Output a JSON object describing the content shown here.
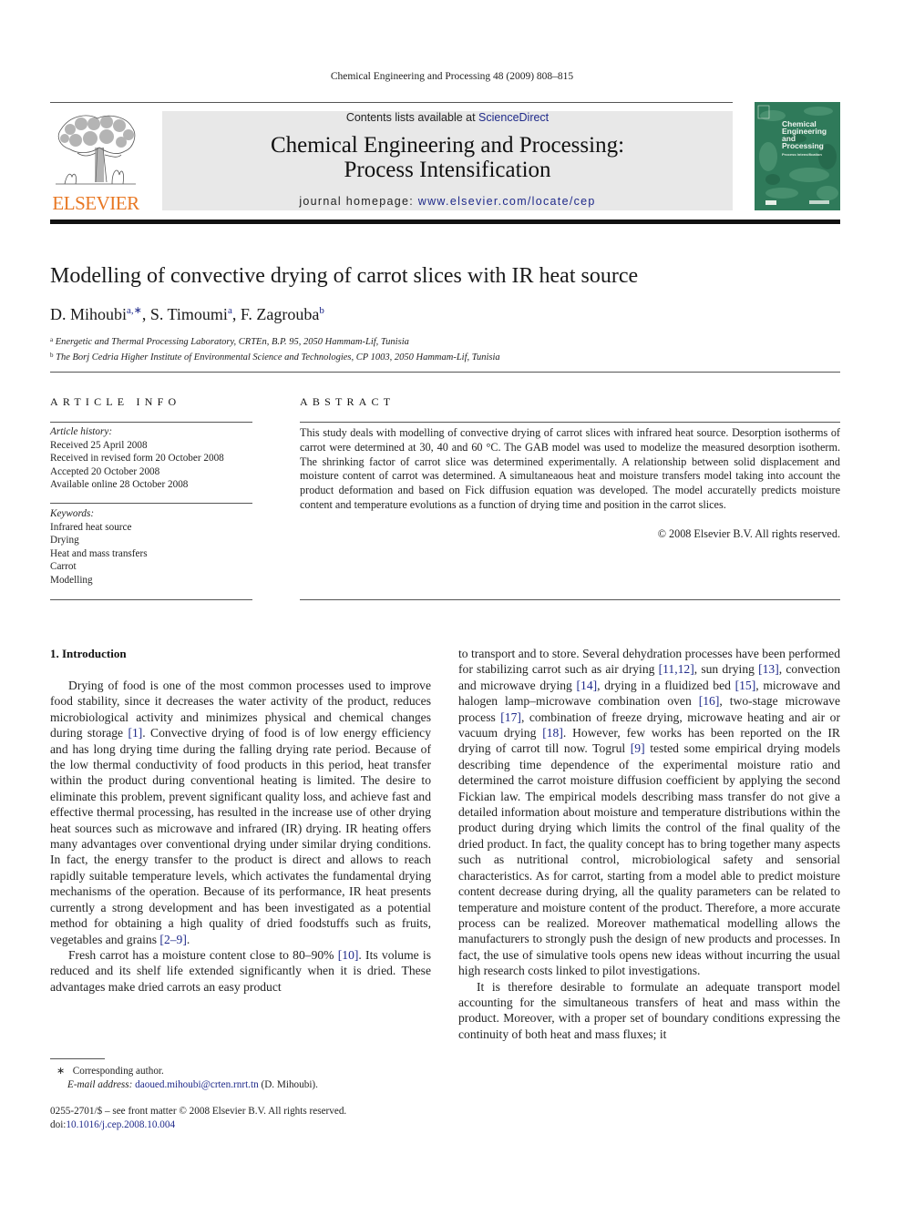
{
  "running_header": "Chemical Engineering and Processing 48 (2009) 808–815",
  "publisher": {
    "logo_word": "ELSEVIER",
    "logo_color": "#e87722"
  },
  "banner": {
    "contents_prefix": "Contents lists available at ",
    "contents_link": "ScienceDirect",
    "journal_title_line1": "Chemical Engineering and Processing:",
    "journal_title_line2": "Process Intensification",
    "homepage_prefix": "journal homepage: ",
    "homepage_link": "www.elsevier.com/locate/cep",
    "link_color": "#1f2a8a"
  },
  "cover": {
    "title_lines": [
      "Chemical",
      "Engineering",
      "and",
      "Processing"
    ],
    "subtitle": "Process Intensification",
    "color": "#2f7a5a"
  },
  "article": {
    "title": "Modelling of convective drying of carrot slices with IR heat source",
    "authors": [
      {
        "name": "D. Mihoubi",
        "sup": "a,∗",
        "sep": ", "
      },
      {
        "name": "S. Timoumi",
        "sup": "a",
        "sep": ", "
      },
      {
        "name": "F. Zagrouba",
        "sup": "b",
        "sep": ""
      }
    ],
    "affiliations": [
      {
        "mark": "a",
        "text": "Energetic and Thermal Processing Laboratory, CRTEn, B.P. 95, 2050 Hammam-Lif, Tunisia"
      },
      {
        "mark": "b",
        "text": "The Borj Cedria Higher Institute of Environmental Science and Technologies, CP 1003, 2050 Hammam-Lif, Tunisia"
      }
    ]
  },
  "article_info": {
    "heading": "ARTICLE INFO",
    "history_label": "Article history:",
    "history": [
      "Received 25 April 2008",
      "Received in revised form 20 October 2008",
      "Accepted 20 October 2008",
      "Available online 28 October 2008"
    ],
    "keywords_label": "Keywords:",
    "keywords": [
      "Infrared heat source",
      "Drying",
      "Heat and mass transfers",
      "Carrot",
      "Modelling"
    ]
  },
  "abstract": {
    "heading": "ABSTRACT",
    "text": "This study deals with modelling of convective drying of carrot slices with infrared heat source. Desorption isotherms of carrot were determined at 30, 40 and 60 °C. The GAB model was used to modelize the measured desorption isotherm. The shrinking factor of carrot slice was determined experimentally. A relationship between solid displacement and moisture content of carrot was determined. A simultaneaous heat and moisture transfers model taking into account the product deformation and based on Fick diffusion equation was developed. The model accuratelly predicts moisture content and temperature evolutions as a function of drying time and position in the carrot slices.",
    "copyright": "© 2008 Elsevier B.V. All rights reserved."
  },
  "introduction": {
    "heading": "1.  Introduction",
    "left_paragraphs": [
      [
        {
          "t": "Drying of food is one of the most common processes used to improve food stability, since it decreases the water activity of the product, reduces microbiological activity and minimizes physical and chemical changes during storage "
        },
        {
          "ref": "[1]"
        },
        {
          "t": ". Convective drying of food is of low energy efficiency and has long drying time during the falling drying rate period. Because of the low thermal conductivity of food products in this period, heat transfer within the product during conventional heating is limited. The desire to eliminate this problem, prevent significant quality loss, and achieve fast and effective thermal processing, has resulted in the increase use of other drying heat sources such as microwave and infrared (IR) drying. IR heating offers many advantages over conventional drying under similar drying conditions. In fact, the energy transfer to the product is direct and allows to reach rapidly suitable temperature levels, which activates the fundamental drying mechanisms of the operation. Because of its performance, IR heat presents currently a strong development and has been investigated as a potential method for obtaining a high quality of dried foodstuffs such as fruits, vegetables and grains "
        },
        {
          "ref": "[2–9]"
        },
        {
          "t": "."
        }
      ],
      [
        {
          "t": "Fresh carrot has a moisture content close to 80–90% "
        },
        {
          "ref": "[10]"
        },
        {
          "t": ". Its volume is reduced and its shelf life extended significantly when it is dried. These advantages make dried carrots an easy product"
        }
      ]
    ],
    "right_paragraphs": [
      [
        {
          "t": "to transport and to store. Several dehydration processes have been performed for stabilizing carrot such as air drying "
        },
        {
          "ref": "[11,12]"
        },
        {
          "t": ", sun drying "
        },
        {
          "ref": "[13]"
        },
        {
          "t": ", convection and microwave drying "
        },
        {
          "ref": "[14]"
        },
        {
          "t": ", drying in a fluidized bed "
        },
        {
          "ref": "[15]"
        },
        {
          "t": ", microwave and halogen lamp–microwave combination oven "
        },
        {
          "ref": "[16]"
        },
        {
          "t": ", two-stage microwave process "
        },
        {
          "ref": "[17]"
        },
        {
          "t": ", combination of freeze drying, microwave heating and air or vacuum drying "
        },
        {
          "ref": "[18]"
        },
        {
          "t": ". However, few works has been reported on the IR drying of carrot till now. Togrul "
        },
        {
          "ref": "[9]"
        },
        {
          "t": " tested some empirical drying models describing time dependence of the experimental moisture ratio and determined the carrot moisture diffusion coefficient by applying the second Fickian law. The empirical models describing mass transfer do not give a detailed information about moisture and temperature distributions within the product during drying which limits the control of the final quality of the dried product. In fact, the quality concept has to bring together many aspects such as nutritional control, microbiological safety and sensorial characteristics. As for carrot, starting from a model able to predict moisture content decrease during drying, all the quality parameters can be related to temperature and moisture content of the product. Therefore, a more accurate process can be realized. Moreover mathematical modelling allows the manufacturers to strongly push the design of new products and processes. In fact, the use of simulative tools opens new ideas without incurring the usual high research costs linked to pilot investigations."
        }
      ],
      [
        {
          "t": "It is therefore desirable to formulate an adequate transport model accounting for the simultaneous transfers of heat and mass within the product. Moreover, with a proper set of boundary conditions expressing the continuity of both heat and mass fluxes; it"
        }
      ]
    ]
  },
  "footnote": {
    "mark": "∗",
    "corresponding": "Corresponding author.",
    "email_label": "E-mail address:",
    "email": "daoued.mihoubi@crten.rnrt.tn",
    "email_suffix": " (D. Mihoubi)."
  },
  "front_matter": {
    "issn_line": "0255-2701/$ – see front matter © 2008 Elsevier B.V. All rights reserved.",
    "doi_prefix": "doi:",
    "doi": "10.1016/j.cep.2008.10.004"
  }
}
